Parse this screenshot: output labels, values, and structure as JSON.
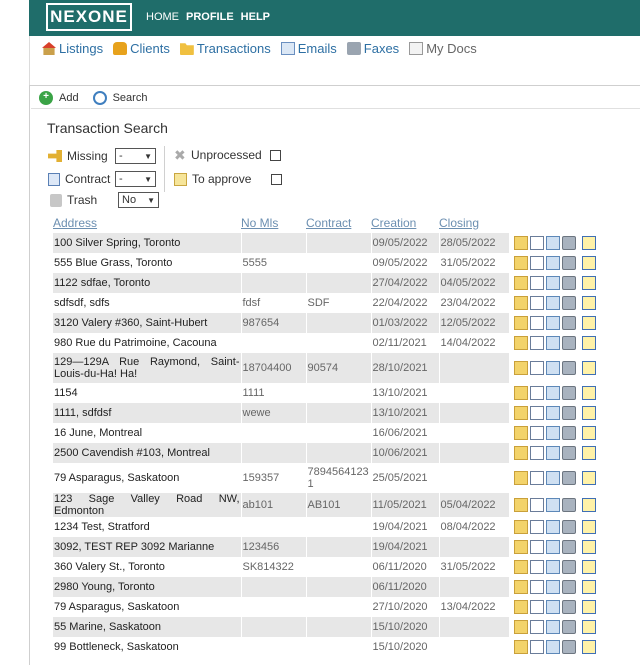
{
  "brand": "NEXONE",
  "topnav": [
    "HOME",
    "PROFILE",
    "HELP"
  ],
  "subnav": [
    {
      "label": "Listings",
      "icon": "house-icon"
    },
    {
      "label": "Clients",
      "icon": "clients-icon"
    },
    {
      "label": "Transactions",
      "icon": "folder-icon"
    },
    {
      "label": "Emails",
      "icon": "mail-icon"
    },
    {
      "label": "Faxes",
      "icon": "fax-icon"
    },
    {
      "label": "My Docs",
      "icon": "docs-icon"
    }
  ],
  "toolbar": {
    "add": "Add",
    "search": "Search"
  },
  "title": "Transaction Search",
  "filters": {
    "missing_label": "Missing",
    "missing_value": "-",
    "contract_label": "Contract",
    "contract_value": "-",
    "trash_label": "Trash",
    "trash_value": "No",
    "unprocessed_label": "Unprocessed",
    "approve_label": "To approve"
  },
  "columns": [
    "Address",
    "No Mls",
    "Contract",
    "Creation",
    "Closing"
  ],
  "rows": [
    {
      "address": "100 Silver Spring, Toronto",
      "mls": "",
      "contract": "",
      "creation": "09/05/2022",
      "closing": "28/05/2022"
    },
    {
      "address": "555 Blue Grass, Toronto",
      "mls": "5555",
      "contract": "",
      "creation": "09/05/2022",
      "closing": "31/05/2022"
    },
    {
      "address": "1122 sdfae, Toronto",
      "mls": "",
      "contract": "",
      "creation": "27/04/2022",
      "closing": "04/05/2022"
    },
    {
      "address": "sdfsdf, sdfs",
      "mls": "fdsf",
      "contract": "SDF",
      "creation": "22/04/2022",
      "closing": "23/04/2022"
    },
    {
      "address": "3120 Valery #360, Saint-Hubert",
      "mls": "987654",
      "contract": "",
      "creation": "01/03/2022",
      "closing": "12/05/2022"
    },
    {
      "address": "980 Rue du Patrimoine, Cacouna",
      "mls": "",
      "contract": "",
      "creation": "02/11/2021",
      "closing": "14/04/2022"
    },
    {
      "address": "129—129A Rue Raymond, Saint-Louis-du-Ha! Ha!",
      "mls": "18704400",
      "contract": "90574",
      "creation": "28/10/2021",
      "closing": ""
    },
    {
      "address": "1154",
      "mls": "1111",
      "contract": "",
      "creation": "13/10/2021",
      "closing": ""
    },
    {
      "address": "1111, sdfdsf",
      "mls": "wewe",
      "contract": "",
      "creation": "13/10/2021",
      "closing": ""
    },
    {
      "address": "16 June, Montreal",
      "mls": "",
      "contract": "",
      "creation": "16/06/2021",
      "closing": ""
    },
    {
      "address": "2500 Cavendish #103, Montreal",
      "mls": "",
      "contract": "",
      "creation": "10/06/2021",
      "closing": ""
    },
    {
      "address": "79 Asparagus, Saskatoon",
      "mls": "159357",
      "contract": "78945641231",
      "creation": "25/05/2021",
      "closing": ""
    },
    {
      "address": "123 Sage Valley Road NW, Edmonton",
      "mls": "ab101",
      "contract": "AB101",
      "creation": "11/05/2021",
      "closing": "05/04/2022"
    },
    {
      "address": "1234 Test, Stratford",
      "mls": "",
      "contract": "",
      "creation": "19/04/2021",
      "closing": "08/04/2022"
    },
    {
      "address": "3092, TEST REP 3092 Marianne",
      "mls": "123456",
      "contract": "",
      "creation": "19/04/2021",
      "closing": ""
    },
    {
      "address": "360 Valery St., Toronto",
      "mls": "SK814322",
      "contract": "",
      "creation": "06/11/2020",
      "closing": "31/05/2022"
    },
    {
      "address": "2980 Young, Toronto",
      "mls": "",
      "contract": "",
      "creation": "06/11/2020",
      "closing": ""
    },
    {
      "address": "79 Asparagus, Saskatoon",
      "mls": "",
      "contract": "",
      "creation": "27/10/2020",
      "closing": "13/04/2022"
    },
    {
      "address": "55 Marine, Saskatoon",
      "mls": "",
      "contract": "",
      "creation": "15/10/2020",
      "closing": ""
    },
    {
      "address": "99 Bottleneck, Saskatoon",
      "mls": "",
      "contract": "",
      "creation": "15/10/2020",
      "closing": ""
    }
  ],
  "colors": {
    "topbar": "#1f6d6a",
    "link": "#2d6fa3",
    "row_alt": "#e7e7e7"
  }
}
